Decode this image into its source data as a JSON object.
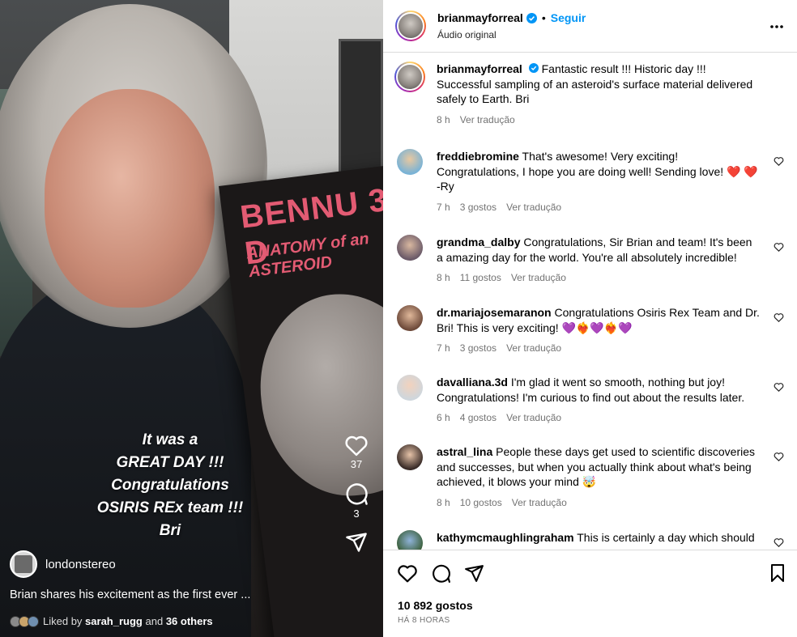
{
  "video": {
    "overlay_lines": [
      "It was a",
      "GREAT DAY !!!",
      "Congratulations",
      "OSIRIS REx team !!!",
      "Bri"
    ],
    "poster_title": "BENNU 3-D",
    "poster_subtitle": "ANATOMY of an ASTEROID",
    "like_count": "37",
    "comment_count": "3",
    "author": "londonstereo",
    "caption": "Brian shares his excitement as the  first ever ...",
    "liked_by_prefix": "Liked by",
    "liked_by_user": "sarah_rugg",
    "liked_by_and": "and",
    "liked_by_others": "36 others"
  },
  "header": {
    "username": "brianmayforreal",
    "follow_label": "Seguir",
    "subtitle": "Áudio original"
  },
  "post": {
    "username": "brianmayforreal",
    "text": "Fantastic result !!! Historic day !!! Successful sampling of an asteroid's surface material delivered safely to Earth. Bri",
    "time": "8 h",
    "translate": "Ver tradução"
  },
  "comments": [
    {
      "username": "freddiebromine",
      "text": "That's awesome! Very exciting! Congratulations, I hope you are doing well! Sending love! ❤️ ❤️ -Ry",
      "time": "7 h",
      "likes": "3 gostos",
      "translate": "Ver tradução"
    },
    {
      "username": "grandma_dalby",
      "text": "Congratulations, Sir Brian and team! It's been a amazing day for the world. You're all absolutely incredible!",
      "time": "8 h",
      "likes": "11 gostos",
      "translate": "Ver tradução"
    },
    {
      "username": "dr.mariajosemaranon",
      "text": "Congratulations Osiris Rex Team and Dr. Bri! This is very exciting! 💜❤️‍🔥💜❤️‍🔥💜",
      "time": "7 h",
      "likes": "3 gostos",
      "translate": "Ver tradução"
    },
    {
      "username": "davalliana.3d",
      "text": "I'm glad it went so smooth, nothing but joy! Congratulations! I'm curious to find out about the results later.",
      "time": "6 h",
      "likes": "4 gostos",
      "translate": "Ver tradução"
    },
    {
      "username": "astral_lina",
      "text": "People these days get used to scientific discoveries and successes, but when you actually think about what's being achieved, it blows your mind 🤯",
      "time": "8 h",
      "likes": "10 gostos",
      "translate": "Ver tradução"
    },
    {
      "username": "kathymcmaughlingraham",
      "text": "This is certainly a day which should",
      "time": "",
      "likes": "",
      "translate": ""
    }
  ],
  "footer": {
    "likes": "10 892 gostos",
    "ago": "HÁ 8 HORAS"
  },
  "colors": {
    "link": "#0095f6",
    "verified": "#0095f6",
    "muted": "#737373"
  },
  "icons": [
    "heart-icon",
    "comment-icon",
    "share-icon",
    "bookmark-icon",
    "more-icon",
    "verified-icon"
  ]
}
